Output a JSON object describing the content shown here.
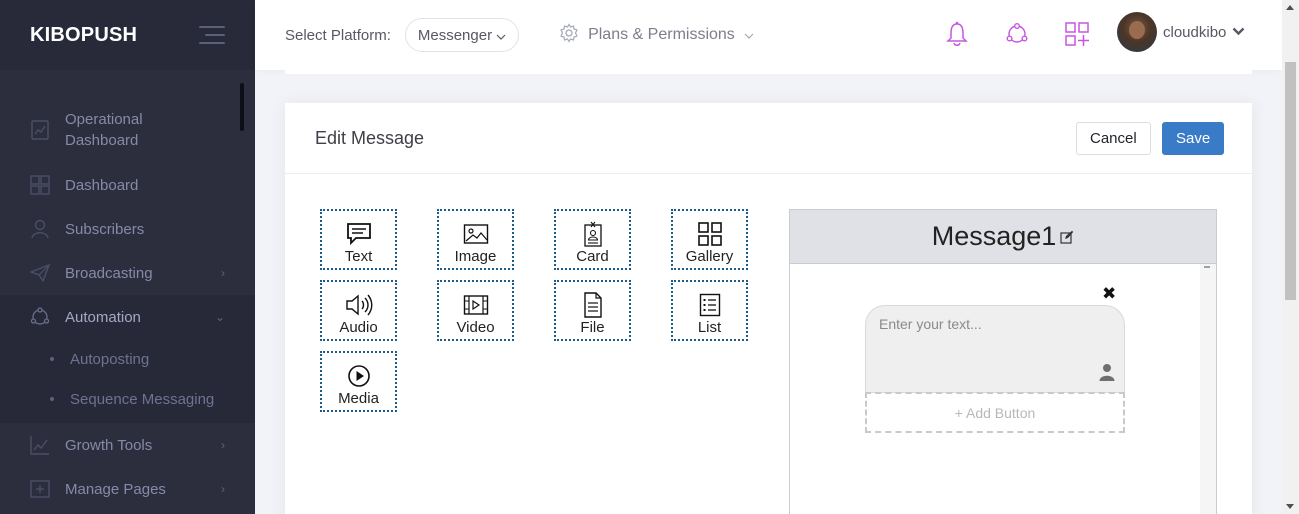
{
  "sidebar": {
    "brand": "KIBOPUSH",
    "items": [
      {
        "label": "Operational Dashboard",
        "icon": "chart-icon",
        "line1": "Operational",
        "line2": "Dashboard"
      },
      {
        "label": "Dashboard",
        "icon": "dashboard-icon"
      },
      {
        "label": "Subscribers",
        "icon": "user-icon"
      },
      {
        "label": "Broadcasting",
        "icon": "paper-plane-icon",
        "arrow": "›"
      },
      {
        "label": "Automation",
        "icon": "network-icon",
        "arrow": "⌄"
      },
      {
        "label": "Growth Tools",
        "icon": "growth-chart-icon",
        "arrow": "›"
      },
      {
        "label": "Manage Pages",
        "icon": "add-page-icon",
        "arrow": "›"
      }
    ],
    "submenu": [
      "Autoposting",
      "Sequence Messaging"
    ]
  },
  "topbar": {
    "platform_label": "Select Platform:",
    "platform_value": "Messenger",
    "plans_label": "Plans & Permissions",
    "username": "cloudkibo",
    "accent_color": "#c855e0"
  },
  "editor": {
    "title": "Edit Message",
    "cancel_label": "Cancel",
    "save_label": "Save",
    "components": [
      {
        "label": "Text",
        "icon": "text-bubble-icon"
      },
      {
        "label": "Image",
        "icon": "image-icon"
      },
      {
        "label": "Card",
        "icon": "card-icon"
      },
      {
        "label": "Gallery",
        "icon": "gallery-icon"
      },
      {
        "label": "Audio",
        "icon": "audio-icon"
      },
      {
        "label": "Video",
        "icon": "video-icon"
      },
      {
        "label": "File",
        "icon": "file-icon"
      },
      {
        "label": "List",
        "icon": "list-icon"
      },
      {
        "label": "Media",
        "icon": "play-icon"
      }
    ]
  },
  "preview": {
    "title": "Message1",
    "text_placeholder": "Enter your text...",
    "close_symbol": "✖",
    "add_button_label": "+ Add Button"
  }
}
